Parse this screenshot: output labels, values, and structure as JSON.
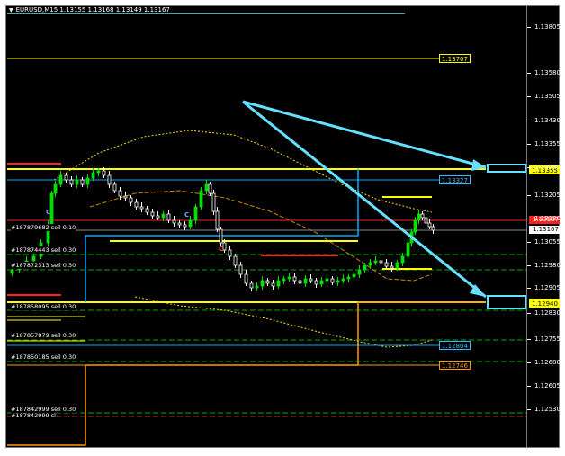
{
  "window": {
    "symbol_header": "EURUSD,M15  1.13155 1.13168 1.13149 1.13167",
    "dropdown_icon": "triangle-down-icon"
  },
  "price_axis": {
    "ticks": [
      "1.13805",
      "1.13580",
      "1.13505",
      "1.13430",
      "1.13355",
      "1.13280",
      "1.13205",
      "1.13130",
      "1.13055",
      "1.12980",
      "1.12905",
      "1.12830",
      "1.12755",
      "1.12680",
      "1.12605",
      "1.12530"
    ],
    "current_bid": "1.13167",
    "red_level_label": "1.13187"
  },
  "level_labels": {
    "l1": "1.13707",
    "l2": "1.13355",
    "l3": "1.13327",
    "l4": "1.12940",
    "l5": "1.12804",
    "l6": "1.12746"
  },
  "orders": [
    "#187879682 sell 0.10",
    "#187874443 sell 0.30",
    "#187872313 sell 0.30",
    "#187858095 sell 0.30",
    "#187857879 sell 0.30",
    "#187850185 sell 0.30",
    "#187842999 sell 0.30",
    "#187842999 sl"
  ],
  "wave_marks": [
    "C",
    "C",
    "C"
  ],
  "colors": {
    "background": "#000000",
    "bull_candle": "#00e000",
    "bear_candle": "#ffffff",
    "yellow_level": "#ffff00",
    "cyan_level": "#00aaff",
    "orange_line": "#ff9900",
    "red_level": "#ff2020",
    "arrow": "#66e0ff",
    "green_dash": "#00aa00"
  }
}
